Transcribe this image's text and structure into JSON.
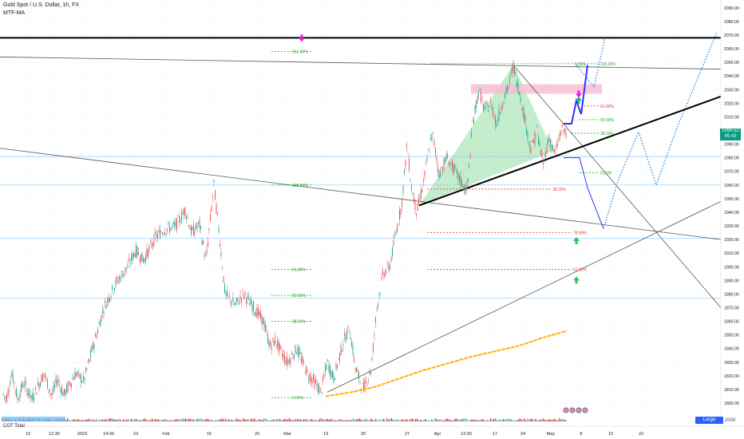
{
  "header": {
    "title": "Gold Spot / U.S. Dollar, 1h, FX",
    "indicator": "MTF-MA"
  },
  "bottom": {
    "indicator_label": "COT Total",
    "large_traders_label": "Large Traders",
    "volume_scale_label": "200K"
  },
  "price_badge": {
    "price": "1999.52",
    "countdown": "45:43"
  },
  "colors": {
    "bull": "#26a69a",
    "bear": "#ef5350",
    "fib_green": "#22aa22",
    "fib_red": "#e53935",
    "projection": "#3030ff",
    "dotted_projection": "#1e88e5",
    "ma": "#ffb300",
    "triangle_fill": "#7bd88f",
    "resistance_zone": "#f8bbd0",
    "arrow_up": "#22c55e",
    "arrow_down": "#e91ee9"
  },
  "chart_data": {
    "type": "line",
    "title": "Gold Spot / U.S. Dollar, 1h, FX",
    "y_ticks": [
      2090,
      2080,
      2070,
      2060,
      2050,
      2040,
      2030,
      2020,
      2010,
      2000,
      1990,
      1980,
      1970,
      1960,
      1950,
      1940,
      1930,
      1920,
      1910,
      1900,
      1890,
      1880,
      1870,
      1860,
      1850,
      1840,
      1830,
      1820,
      1810,
      1800
    ],
    "ylim": [
      1793,
      2094
    ],
    "x_ticks": [
      "19",
      "12:30",
      "2023",
      "14:30",
      "23",
      "Feb",
      "15",
      "20",
      "Mar",
      "13",
      "20",
      "27",
      "Apr",
      "13:30",
      "17",
      "24",
      "May",
      "8",
      "15",
      "22"
    ],
    "current_price": 1999.52,
    "price_path": [
      [
        0,
        1810
      ],
      [
        8,
        1803
      ],
      [
        15,
        1822
      ],
      [
        22,
        1803
      ],
      [
        30,
        1815
      ],
      [
        40,
        1803
      ],
      [
        55,
        1822
      ],
      [
        65,
        1805
      ],
      [
        72,
        1818
      ],
      [
        80,
        1806
      ],
      [
        95,
        1822
      ],
      [
        105,
        1816
      ],
      [
        115,
        1838
      ],
      [
        130,
        1870
      ],
      [
        145,
        1888
      ],
      [
        160,
        1900
      ],
      [
        170,
        1912
      ],
      [
        180,
        1905
      ],
      [
        195,
        1922
      ],
      [
        205,
        1927
      ],
      [
        220,
        1930
      ],
      [
        232,
        1942
      ],
      [
        240,
        1925
      ],
      [
        250,
        1931
      ],
      [
        258,
        1904
      ],
      [
        268,
        1960
      ],
      [
        275,
        1922
      ],
      [
        282,
        1880
      ],
      [
        295,
        1872
      ],
      [
        305,
        1880
      ],
      [
        318,
        1870
      ],
      [
        330,
        1860
      ],
      [
        338,
        1842
      ],
      [
        345,
        1846
      ],
      [
        352,
        1838
      ],
      [
        360,
        1830
      ],
      [
        372,
        1840
      ],
      [
        385,
        1822
      ],
      [
        395,
        1815
      ],
      [
        402,
        1808
      ],
      [
        410,
        1830
      ],
      [
        418,
        1818
      ],
      [
        430,
        1845
      ],
      [
        438,
        1855
      ],
      [
        445,
        1826
      ],
      [
        455,
        1810
      ],
      [
        465,
        1825
      ],
      [
        472,
        1870
      ],
      [
        480,
        1895
      ],
      [
        488,
        1900
      ],
      [
        495,
        1922
      ],
      [
        503,
        1945
      ],
      [
        510,
        1990
      ],
      [
        515,
        1960
      ],
      [
        522,
        1940
      ],
      [
        530,
        1960
      ],
      [
        537,
        1985
      ],
      [
        542,
        1998
      ],
      [
        550,
        1968
      ],
      [
        560,
        1980
      ],
      [
        575,
        1965
      ],
      [
        585,
        1955
      ],
      [
        592,
        2005
      ],
      [
        600,
        2030
      ],
      [
        607,
        2015
      ],
      [
        615,
        2020
      ],
      [
        622,
        2005
      ],
      [
        630,
        2022
      ],
      [
        637,
        2032
      ],
      [
        643,
        2048
      ],
      [
        650,
        2030
      ],
      [
        657,
        2010
      ],
      [
        665,
        1985
      ],
      [
        673,
        2000
      ],
      [
        680,
        1975
      ],
      [
        688,
        1995
      ],
      [
        695,
        1982
      ],
      [
        703,
        2000
      ],
      [
        710,
        1999.5
      ]
    ],
    "fibonacci_levels": [
      {
        "label": "161.80%",
        "price": 2058,
        "color": "green"
      },
      {
        "label": "100.00%",
        "price": 1960,
        "color": "green"
      },
      {
        "label": "61.80%",
        "price": 1898,
        "color": "green"
      },
      {
        "label": "50.00%",
        "price": 1879,
        "color": "green"
      },
      {
        "label": "38.20%",
        "price": 1860,
        "color": "green"
      },
      {
        "label": "0.00%",
        "price": 1804,
        "color": "green"
      },
      {
        "label": "0.00%",
        "price": 2049,
        "color": "green"
      },
      {
        "label": "100.00%",
        "price": 2049,
        "color": "green"
      },
      {
        "label": "61.80%",
        "price": 2018,
        "color": "red"
      },
      {
        "label": "50.00%",
        "price": 2008,
        "color": "green"
      },
      {
        "label": "38.20%",
        "price": 1998,
        "color": "green"
      },
      {
        "label": "0.00%",
        "price": 1969,
        "color": "green"
      },
      {
        "label": "38.20%",
        "price": 1957,
        "color": "red"
      },
      {
        "label": "78.60%",
        "price": 1925,
        "color": "red"
      },
      {
        "label": "61.80%",
        "price": 1898,
        "color": "red"
      }
    ],
    "moving_average": [
      [
        408,
        1805
      ],
      [
        440,
        1808
      ],
      [
        470,
        1812
      ],
      [
        500,
        1818
      ],
      [
        530,
        1824
      ],
      [
        560,
        1829
      ],
      [
        590,
        1834
      ],
      [
        620,
        1838
      ],
      [
        650,
        1842
      ],
      [
        680,
        1848
      ],
      [
        710,
        1853
      ]
    ],
    "horizontal_levels": [
      2068,
      1981,
      1960,
      1921,
      1877
    ],
    "projection_up": [
      [
        706,
        2005
      ],
      [
        716,
        2005
      ],
      [
        722,
        2022
      ],
      [
        728,
        2012
      ],
      [
        736,
        2048
      ]
    ],
    "projection_down": [
      [
        706,
        1980
      ],
      [
        726,
        1980
      ],
      [
        736,
        1958
      ],
      [
        756,
        1928
      ]
    ],
    "dotted_projection_a": [
      [
        722,
        2048
      ],
      [
        744,
        2032
      ],
      [
        758,
        2068
      ]
    ],
    "dotted_projection_b": [
      [
        756,
        1928
      ],
      [
        774,
        1963
      ],
      [
        800,
        1999
      ],
      [
        822,
        1960
      ],
      [
        848,
        2002
      ],
      [
        898,
        2072
      ]
    ]
  }
}
